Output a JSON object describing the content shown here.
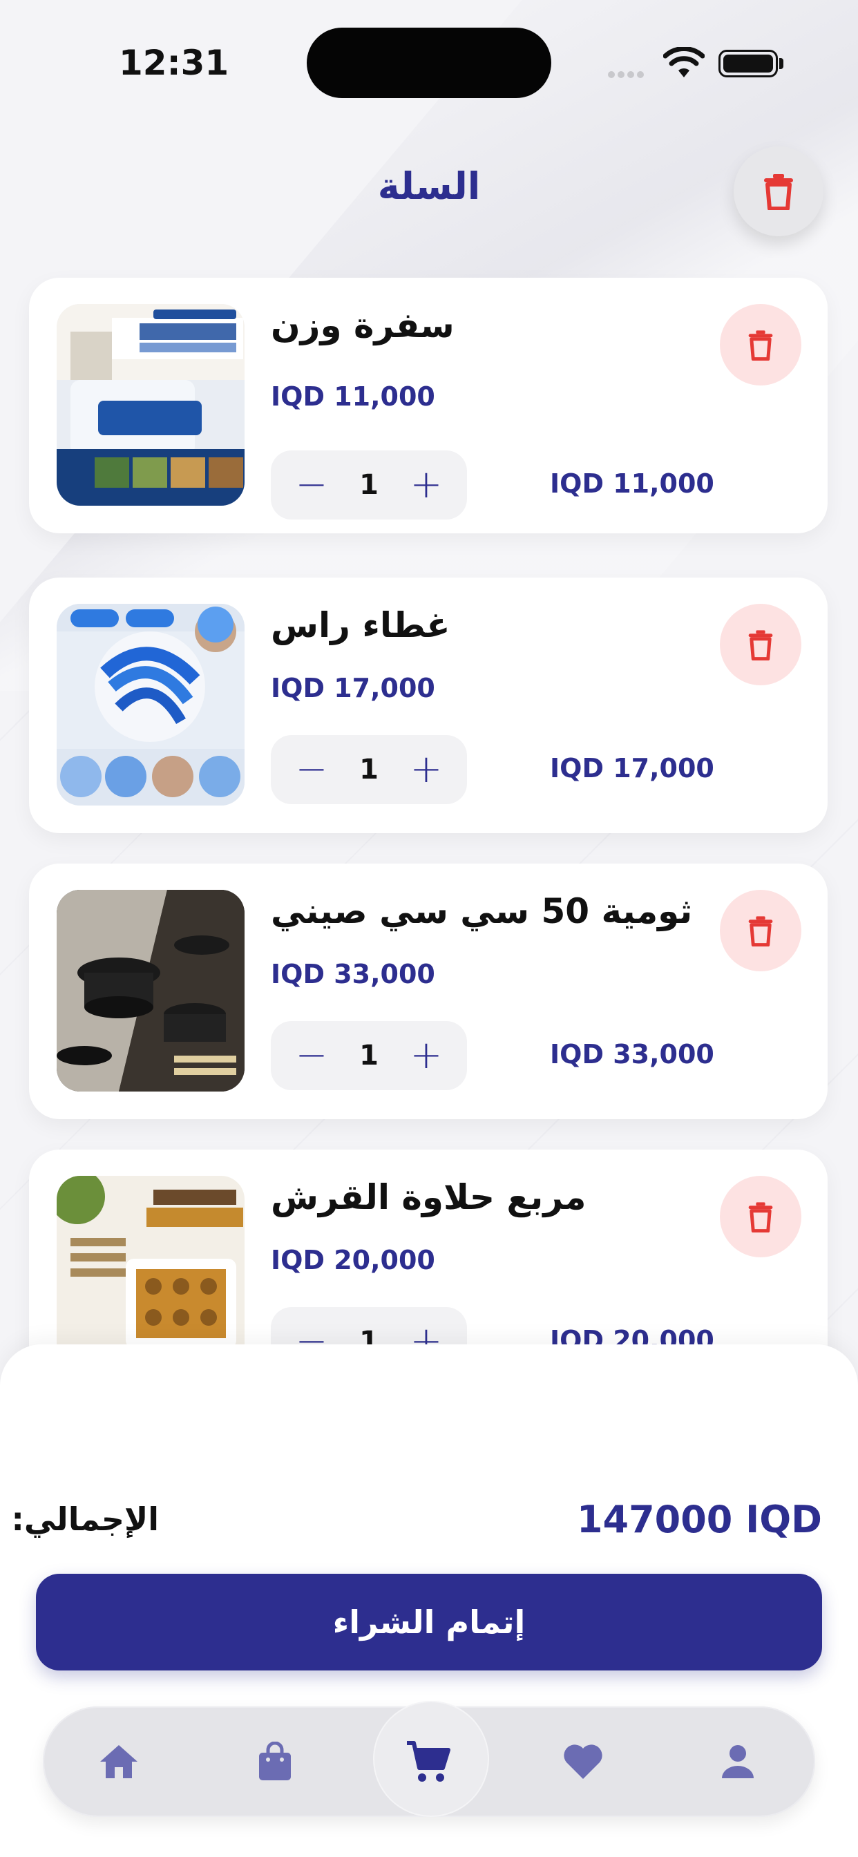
{
  "status_bar": {
    "time": "12:31"
  },
  "header": {
    "title": "السلة"
  },
  "cart_items": [
    {
      "name": "سفرة وزن",
      "price": "IQD 11,000",
      "quantity": "1",
      "line_total": "IQD 11,000"
    },
    {
      "name": "غطاء راس",
      "price": "IQD 17,000",
      "quantity": "1",
      "line_total": "IQD 17,000"
    },
    {
      "name": "ثومية 50 سي سي صيني",
      "price": "IQD 33,000",
      "quantity": "1",
      "line_total": "IQD 33,000"
    },
    {
      "name": "مربع حلاوة القرش",
      "price": "IQD 20,000",
      "quantity": "1",
      "line_total": "IQD 20,000"
    }
  ],
  "summary": {
    "total_label": "الإجمالي:",
    "total_value": "147000 IQD"
  },
  "checkout": {
    "label": "إتمام الشراء"
  },
  "tabbar": {
    "items": [
      {
        "icon": "home-icon"
      },
      {
        "icon": "shopping-bag-icon"
      },
      {
        "icon": "cart-icon",
        "active": true
      },
      {
        "icon": "heart-icon"
      },
      {
        "icon": "user-icon"
      }
    ]
  },
  "colors": {
    "accent": "#2d2e8f",
    "delete": "#e53935",
    "delete_bg": "#fde2e2",
    "text": "#111111"
  }
}
